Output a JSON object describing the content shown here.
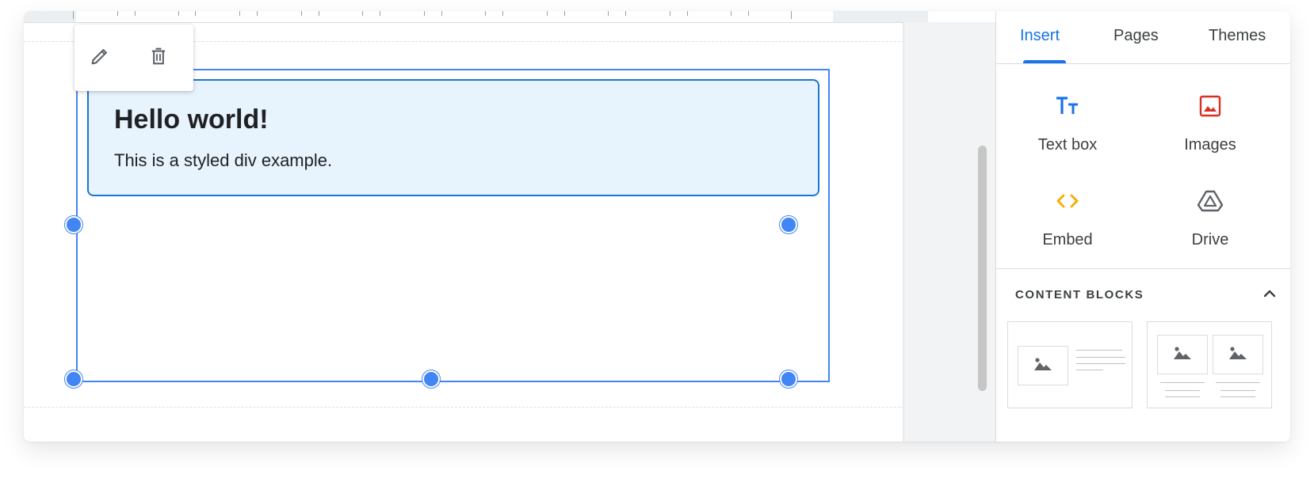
{
  "toolbar": {
    "edit_icon": "pencil-icon",
    "delete_icon": "trash-icon"
  },
  "canvas": {
    "heading": "Hello world!",
    "body_text": "This is a styled div example.",
    "selection_color": "#4285f4",
    "div_border_color": "#1976d2",
    "div_background": "#e8f4fd"
  },
  "panel": {
    "tabs": [
      {
        "label": "Insert",
        "active": true
      },
      {
        "label": "Pages",
        "active": false
      },
      {
        "label": "Themes",
        "active": false
      }
    ],
    "insert_items": [
      {
        "label": "Text box",
        "icon": "text-box-icon",
        "color": "#1a73e8"
      },
      {
        "label": "Images",
        "icon": "image-icon",
        "color": "#d93025"
      },
      {
        "label": "Embed",
        "icon": "embed-code-icon",
        "color": "#f9ab00"
      },
      {
        "label": "Drive",
        "icon": "drive-icon",
        "color": "#5f6368"
      }
    ],
    "content_blocks": {
      "title": "CONTENT BLOCKS",
      "expanded": true
    },
    "accent": "#1a73e8"
  }
}
